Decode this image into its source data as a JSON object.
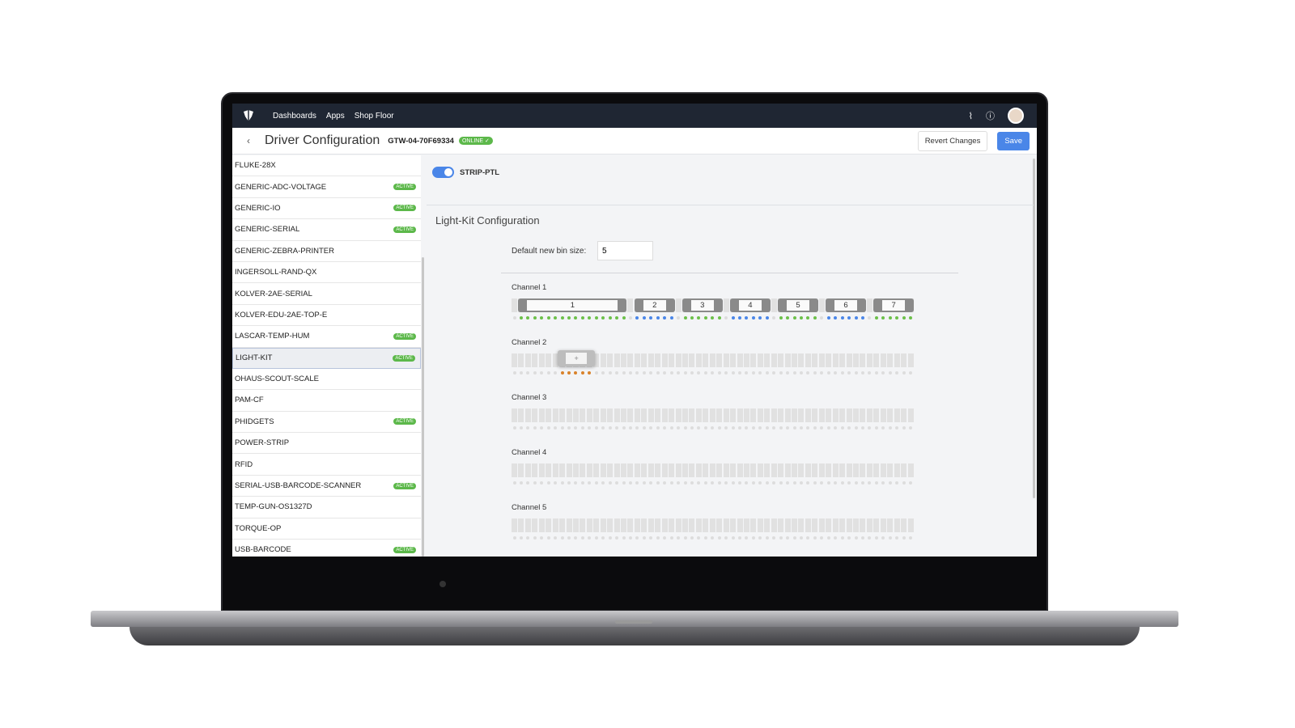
{
  "nav": {
    "items": [
      "Dashboards",
      "Apps",
      "Shop Floor"
    ],
    "activity_icon": "pulse-icon",
    "help_icon": "help-icon"
  },
  "header": {
    "back": "‹",
    "title": "Driver Configuration",
    "gateway": "GTW-04-70F69334",
    "status": "ONLINE ✓",
    "revert": "Revert Changes",
    "save": "Save"
  },
  "drivers": [
    {
      "name": "FLUKE-28X",
      "active": false
    },
    {
      "name": "GENERIC-ADC-VOLTAGE",
      "active": true
    },
    {
      "name": "GENERIC-IO",
      "active": true
    },
    {
      "name": "GENERIC-SERIAL",
      "active": true
    },
    {
      "name": "GENERIC-ZEBRA-PRINTER",
      "active": false
    },
    {
      "name": "INGERSOLL-RAND-QX",
      "active": false
    },
    {
      "name": "KOLVER-2AE-SERIAL",
      "active": false
    },
    {
      "name": "KOLVER-EDU-2AE-TOP-E",
      "active": false
    },
    {
      "name": "LASCAR-TEMP-HUM",
      "active": true
    },
    {
      "name": "LIGHT-KIT",
      "active": true,
      "selected": true
    },
    {
      "name": "OHAUS-SCOUT-SCALE",
      "active": false
    },
    {
      "name": "PAM-CF",
      "active": false
    },
    {
      "name": "PHIDGETS",
      "active": true
    },
    {
      "name": "POWER-STRIP",
      "active": false
    },
    {
      "name": "RFID",
      "active": false
    },
    {
      "name": "SERIAL-USB-BARCODE-SCANNER",
      "active": true
    },
    {
      "name": "TEMP-GUN-OS1327D",
      "active": false
    },
    {
      "name": "TORQUE-OP",
      "active": false
    },
    {
      "name": "USB-BARCODE",
      "active": true
    }
  ],
  "active_label": "ACTIVE",
  "main": {
    "driver": "STRIP-PTL",
    "enabled": true,
    "section": "Light-Kit Configuration",
    "bin_size_label": "Default new bin size:",
    "bin_size": "5",
    "plus": "+",
    "colors": {
      "green": "#6cc04a",
      "blue": "#4a86e8",
      "orange": "#d9822b"
    },
    "channels": [
      {
        "label": "Channel 1",
        "leds": 59,
        "bins": [
          {
            "label": "1",
            "start": 1,
            "size": 16,
            "color": "green"
          },
          {
            "label": "2",
            "start": 18,
            "size": 6,
            "color": "blue"
          },
          {
            "label": "3",
            "start": 25,
            "size": 6,
            "color": "green"
          },
          {
            "label": "4",
            "start": 32,
            "size": 6,
            "color": "blue"
          },
          {
            "label": "5",
            "start": 39,
            "size": 6,
            "color": "green"
          },
          {
            "label": "6",
            "start": 46,
            "size": 6,
            "color": "blue"
          },
          {
            "label": "7",
            "start": 53,
            "size": 6,
            "color": "green"
          }
        ]
      },
      {
        "label": "Channel 2",
        "leds": 59,
        "bins": [],
        "pending": {
          "start": 7,
          "size": 5,
          "color": "orange"
        }
      },
      {
        "label": "Channel 3",
        "leds": 59,
        "bins": []
      },
      {
        "label": "Channel 4",
        "leds": 59,
        "bins": []
      },
      {
        "label": "Channel 5",
        "leds": 59,
        "bins": []
      }
    ]
  }
}
